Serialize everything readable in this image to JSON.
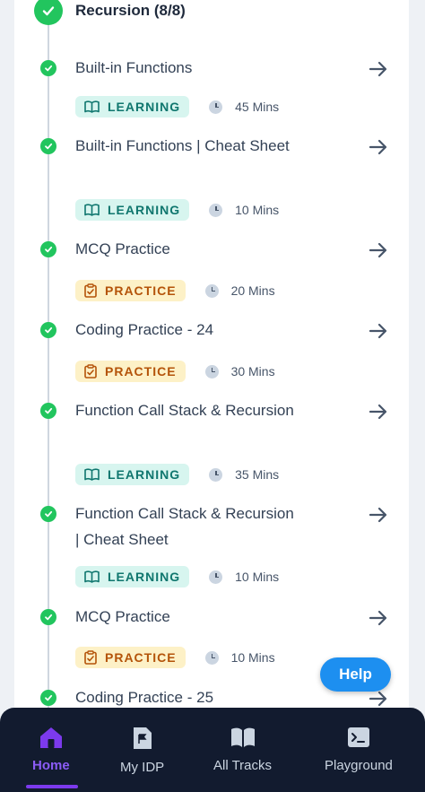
{
  "section": {
    "title": "Recursion (8/8)"
  },
  "items": [
    {
      "title": "Built-in Functions",
      "type": "learning",
      "badge": "LEARNING",
      "duration": "45 Mins"
    },
    {
      "title": "Built-in Functions | Cheat Sheet",
      "type": "learning",
      "badge": "LEARNING",
      "duration": "10 Mins"
    },
    {
      "title": "MCQ Practice",
      "type": "practice",
      "badge": "PRACTICE",
      "duration": "20 Mins"
    },
    {
      "title": "Coding Practice - 24",
      "type": "practice",
      "badge": "PRACTICE",
      "duration": "30 Mins"
    },
    {
      "title": "Function Call Stack & Recursion",
      "type": "learning",
      "badge": "LEARNING",
      "duration": "35 Mins"
    },
    {
      "title": "Function Call Stack & Recursion | Cheat Sheet",
      "type": "learning",
      "badge": "LEARNING",
      "duration": "10 Mins"
    },
    {
      "title": "MCQ Practice",
      "type": "practice",
      "badge": "PRACTICE",
      "duration": "10 Mins"
    },
    {
      "title": "Coding Practice - 25"
    }
  ],
  "help": {
    "label": "Help"
  },
  "nav": [
    {
      "label": "Home",
      "icon": "home-icon",
      "active": true
    },
    {
      "label": "My IDP",
      "icon": "flag-document-icon",
      "active": false
    },
    {
      "label": "All Tracks",
      "icon": "open-book-icon",
      "active": false
    },
    {
      "label": "Playground",
      "icon": "terminal-icon",
      "active": false
    }
  ],
  "colors": {
    "success": "#22c55e",
    "learning_bg": "#d7f5ef",
    "practice_bg": "#fdf1c7",
    "accent": "#7c3aed",
    "help": "#1d8ff0"
  }
}
